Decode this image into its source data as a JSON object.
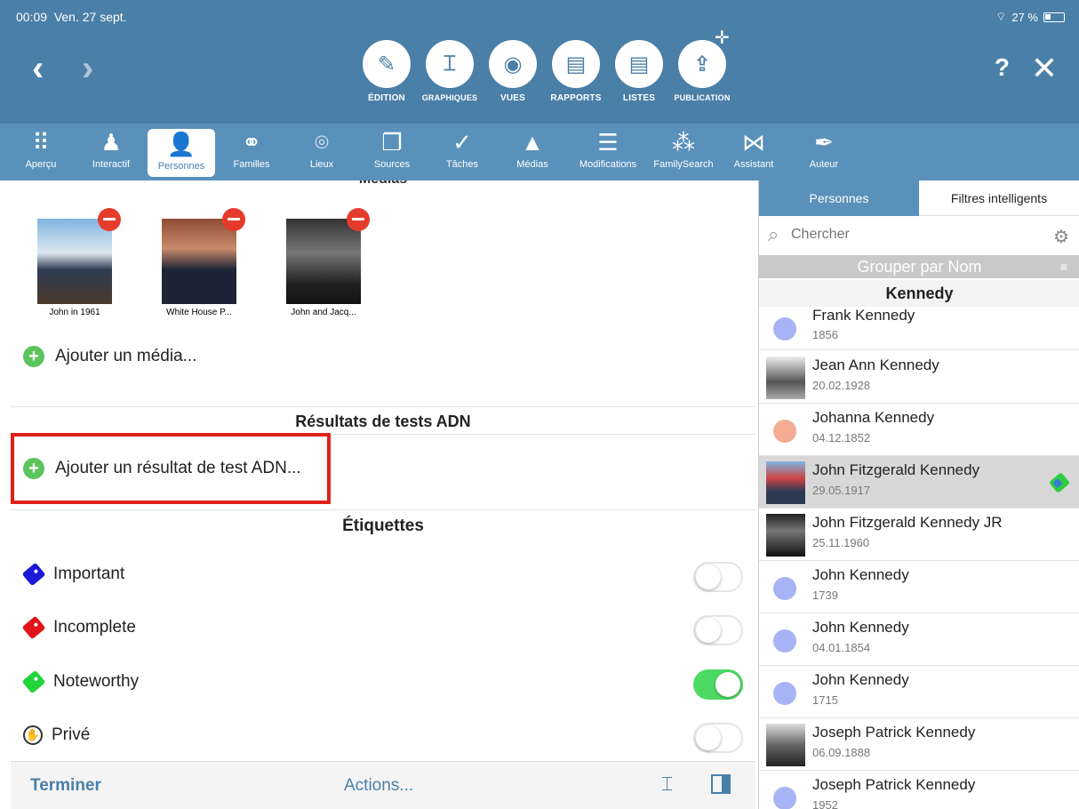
{
  "status": {
    "time": "00:09",
    "date": "Ven. 27 sept.",
    "battery": "27 %"
  },
  "header": {
    "help": "?",
    "close": "✕",
    "modes": [
      {
        "label": "ÉDITION",
        "icon": "pencil-icon",
        "glyph": "✎"
      },
      {
        "label": "GRAPHIQUES",
        "icon": "chart-icon",
        "glyph": "⌶"
      },
      {
        "label": "VUES",
        "icon": "eye-icon",
        "glyph": "◉"
      },
      {
        "label": "RAPPORTS",
        "icon": "report-icon",
        "glyph": "▤"
      },
      {
        "label": "LISTES",
        "icon": "list-icon",
        "glyph": "▤"
      },
      {
        "label": "PUBLICATION",
        "icon": "upload-icon",
        "glyph": "⇪"
      }
    ]
  },
  "toolbar": [
    {
      "label": "Aperçu",
      "glyph": "⠿"
    },
    {
      "label": "Interactif",
      "glyph": "♟"
    },
    {
      "label": "Personnes",
      "glyph": "👤"
    },
    {
      "label": "Familles",
      "glyph": "⚭"
    },
    {
      "label": "Lieux",
      "glyph": "⌾"
    },
    {
      "label": "Sources",
      "glyph": "❐"
    },
    {
      "label": "Tâches",
      "glyph": "✓"
    },
    {
      "label": "Médias",
      "glyph": "▲"
    },
    {
      "label": "Modifications",
      "glyph": "☰"
    },
    {
      "label": "FamilySearch",
      "glyph": "⁂"
    },
    {
      "label": "Assistant",
      "glyph": "⋈"
    },
    {
      "label": "Auteur",
      "glyph": "✒"
    }
  ],
  "editor": {
    "media_heading": "Médias",
    "media": [
      {
        "caption": "John in 1961"
      },
      {
        "caption": "White House P..."
      },
      {
        "caption": "John and Jacq..."
      }
    ],
    "add_media": "Ajouter un média...",
    "dna_title": "Résultats de tests ADN",
    "add_dna": "Ajouter un résultat de test ADN...",
    "labels_title": "Étiquettes",
    "tags": [
      {
        "label": "Important",
        "color": "#1a1ad8",
        "on": false
      },
      {
        "label": "Incomplete",
        "color": "#e0141a",
        "on": false
      },
      {
        "label": "Noteworthy",
        "color": "#22d33a",
        "on": true
      },
      {
        "label": "Privé",
        "color": "#333333",
        "on": false
      }
    ]
  },
  "bottombar": {
    "done": "Terminer",
    "actions": "Actions..."
  },
  "sidebar": {
    "tabs": [
      "Personnes",
      "Filtres intelligents"
    ],
    "search_placeholder": "Chercher",
    "group_label": "Grouper par Nom",
    "section": "Kennedy",
    "people": [
      {
        "name": "Frank Kennedy",
        "date": "1856",
        "kind": "male"
      },
      {
        "name": "Jean Ann Kennedy",
        "date": "20.02.1928",
        "kind": "photo"
      },
      {
        "name": "Johanna Kennedy",
        "date": "04.12.1852",
        "kind": "female"
      },
      {
        "name": "John Fitzgerald Kennedy",
        "date": "29.05.1917",
        "kind": "photo",
        "selected": true
      },
      {
        "name": "John Fitzgerald Kennedy JR",
        "date": "25.11.1960",
        "kind": "photo"
      },
      {
        "name": "John Kennedy",
        "date": "1739",
        "kind": "male"
      },
      {
        "name": "John Kennedy",
        "date": "04.01.1854",
        "kind": "male"
      },
      {
        "name": "John Kennedy",
        "date": "1715",
        "kind": "male"
      },
      {
        "name": "Joseph Patrick Kennedy",
        "date": "06.09.1888",
        "kind": "photo"
      },
      {
        "name": "Joseph Patrick Kennedy",
        "date": "1952",
        "kind": "male"
      }
    ]
  }
}
